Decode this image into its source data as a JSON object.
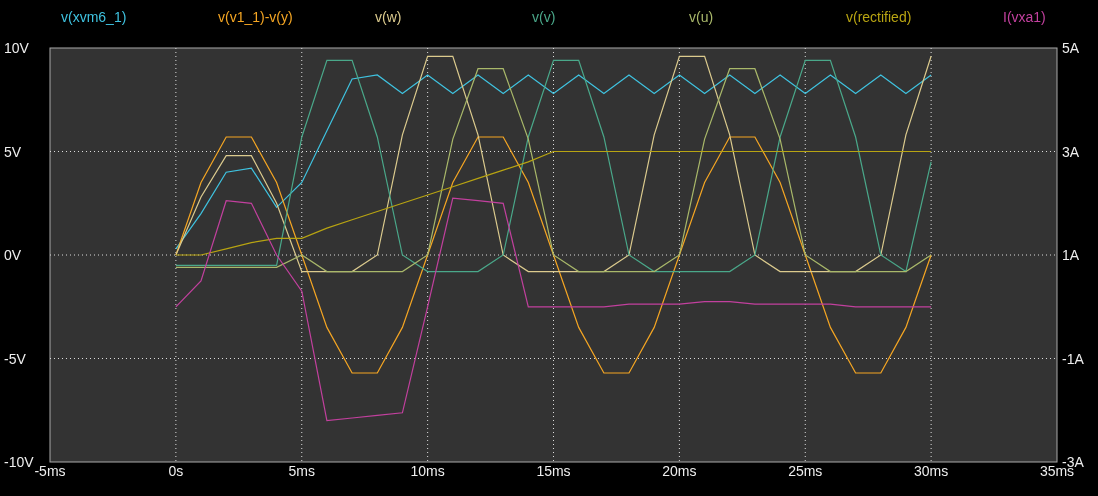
{
  "plot": {
    "chart_data": {
      "type": "line",
      "grid": true,
      "xlim": [
        -5,
        35
      ],
      "ylim": [
        -10,
        10
      ],
      "xticks": [
        {
          "value": -5,
          "label": "-5ms"
        },
        {
          "value": 0,
          "label": "0s"
        },
        {
          "value": 5,
          "label": "5ms"
        },
        {
          "value": 10,
          "label": "10ms"
        },
        {
          "value": 15,
          "label": "15ms"
        },
        {
          "value": 20,
          "label": "20ms"
        },
        {
          "value": 25,
          "label": "25ms"
        },
        {
          "value": 30,
          "label": "30ms"
        },
        {
          "value": 35,
          "label": "35ms"
        }
      ],
      "yticks": [
        {
          "value": 10,
          "label": "10V"
        },
        {
          "value": 5,
          "label": "5V"
        },
        {
          "value": 0,
          "label": "0V"
        },
        {
          "value": -5,
          "label": "-5V"
        },
        {
          "value": -10,
          "label": "-10V"
        }
      ],
      "y2lim": [
        -3,
        5
      ],
      "y2ticks": [
        {
          "value": 5,
          "label": "5A"
        },
        {
          "value": 3,
          "label": "3A"
        },
        {
          "value": 1,
          "label": "1A"
        },
        {
          "value": -1,
          "label": "-1A"
        },
        {
          "value": -3,
          "label": "-3A"
        }
      ],
      "x": [
        0,
        1,
        2,
        3,
        4,
        5,
        6,
        7,
        8,
        9,
        10,
        11,
        12,
        13,
        14,
        15,
        16,
        17,
        18,
        19,
        20,
        21,
        22,
        23,
        24,
        25,
        26,
        27,
        28,
        29,
        30
      ],
      "series": [
        {
          "name": "v(xvm6_1)",
          "color": "#3fc3e0",
          "values": [
            0.3,
            2,
            4,
            4.2,
            2.3,
            3.5,
            6,
            8.5,
            8.7,
            7.8,
            8.7,
            7.8,
            8.7,
            7.8,
            8.7,
            7.8,
            8.7,
            7.8,
            8.7,
            7.8,
            8.7,
            7.8,
            8.7,
            7.8,
            8.7,
            7.8,
            8.7,
            7.8,
            8.7,
            7.8,
            8.7
          ]
        },
        {
          "name": "v(v1_1)-v(y)",
          "color": "#f5a623",
          "values": [
            0,
            3.5,
            5.7,
            5.7,
            3.5,
            0,
            -3.5,
            -5.7,
            -5.7,
            -3.5,
            0,
            3.5,
            5.7,
            5.7,
            3.5,
            0,
            -3.5,
            -5.7,
            -5.7,
            -3.5,
            0,
            3.5,
            5.7,
            5.7,
            3.5,
            0,
            -3.5,
            -5.7,
            -5.7,
            -3.5,
            0
          ]
        },
        {
          "name": "v(w)",
          "color": "#dccb8e",
          "values": [
            0,
            2.8,
            4.8,
            4.8,
            2.5,
            -0.8,
            -0.8,
            -0.8,
            0,
            5.8,
            9.6,
            9.6,
            5.8,
            0,
            -0.8,
            -0.8,
            -0.8,
            -0.8,
            0,
            5.8,
            9.6,
            9.6,
            5.8,
            0,
            -0.8,
            -0.8,
            -0.8,
            -0.8,
            0,
            5.8,
            9.6
          ]
        },
        {
          "name": "v(v)",
          "color": "#4aa88a",
          "values": [
            -0.5,
            -0.5,
            -0.5,
            -0.5,
            -0.5,
            5.7,
            9.4,
            9.4,
            5.7,
            0,
            -0.8,
            -0.8,
            -0.8,
            0,
            5.7,
            9.4,
            9.4,
            5.7,
            0,
            -0.8,
            -0.8,
            -0.8,
            -0.8,
            0,
            5.7,
            9.4,
            9.4,
            5.7,
            0,
            -0.8,
            4.5
          ]
        },
        {
          "name": "v(u)",
          "color": "#a9b86a",
          "values": [
            -0.6,
            -0.6,
            -0.6,
            -0.6,
            -0.6,
            0,
            -0.8,
            -0.8,
            -0.8,
            -0.8,
            0,
            5.6,
            9,
            9,
            5.6,
            0,
            -0.8,
            -0.8,
            -0.8,
            -0.8,
            0,
            5.6,
            9,
            9,
            5.6,
            0,
            -0.8,
            -0.8,
            -0.8,
            -0.8,
            0
          ]
        },
        {
          "name": "v(rectified)",
          "color": "#b8a412",
          "values": [
            0,
            0,
            0.3,
            0.6,
            0.8,
            0.8,
            1.3,
            1.7,
            2.1,
            2.5,
            2.9,
            3.3,
            3.7,
            4.1,
            4.5,
            5,
            5,
            5,
            5,
            5,
            5,
            5,
            5,
            5,
            5,
            5,
            5,
            5,
            5,
            5,
            5
          ]
        },
        {
          "name": "I(vxa1)",
          "color": "#c2409e",
          "axis": "y2",
          "values": [
            0,
            0.5,
            2.05,
            2,
            1,
            0.3,
            -2.2,
            -2.15,
            -2.1,
            -2.05,
            0,
            2.1,
            2.05,
            2,
            0,
            0,
            0,
            0,
            0.05,
            0.05,
            0.05,
            0.1,
            0.1,
            0.05,
            0.05,
            0.05,
            0.05,
            0,
            0,
            0,
            0
          ]
        }
      ]
    }
  }
}
